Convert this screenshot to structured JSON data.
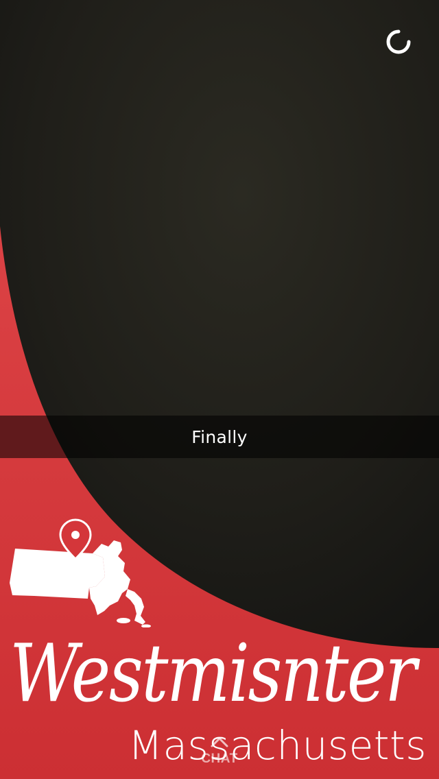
{
  "snap": {
    "caption": "Finally"
  },
  "geofilter": {
    "title": "Westmisnter",
    "subtitle": "Massachusetts",
    "accent_color": "#d4363a",
    "map_icon": "massachusetts-map-icon",
    "pin_icon": "location-pin-icon"
  },
  "footer": {
    "chat_label": "CHAT",
    "chevron_icon": "chevron-up-icon"
  },
  "status": {
    "loading_icon": "loading-spinner-icon"
  }
}
